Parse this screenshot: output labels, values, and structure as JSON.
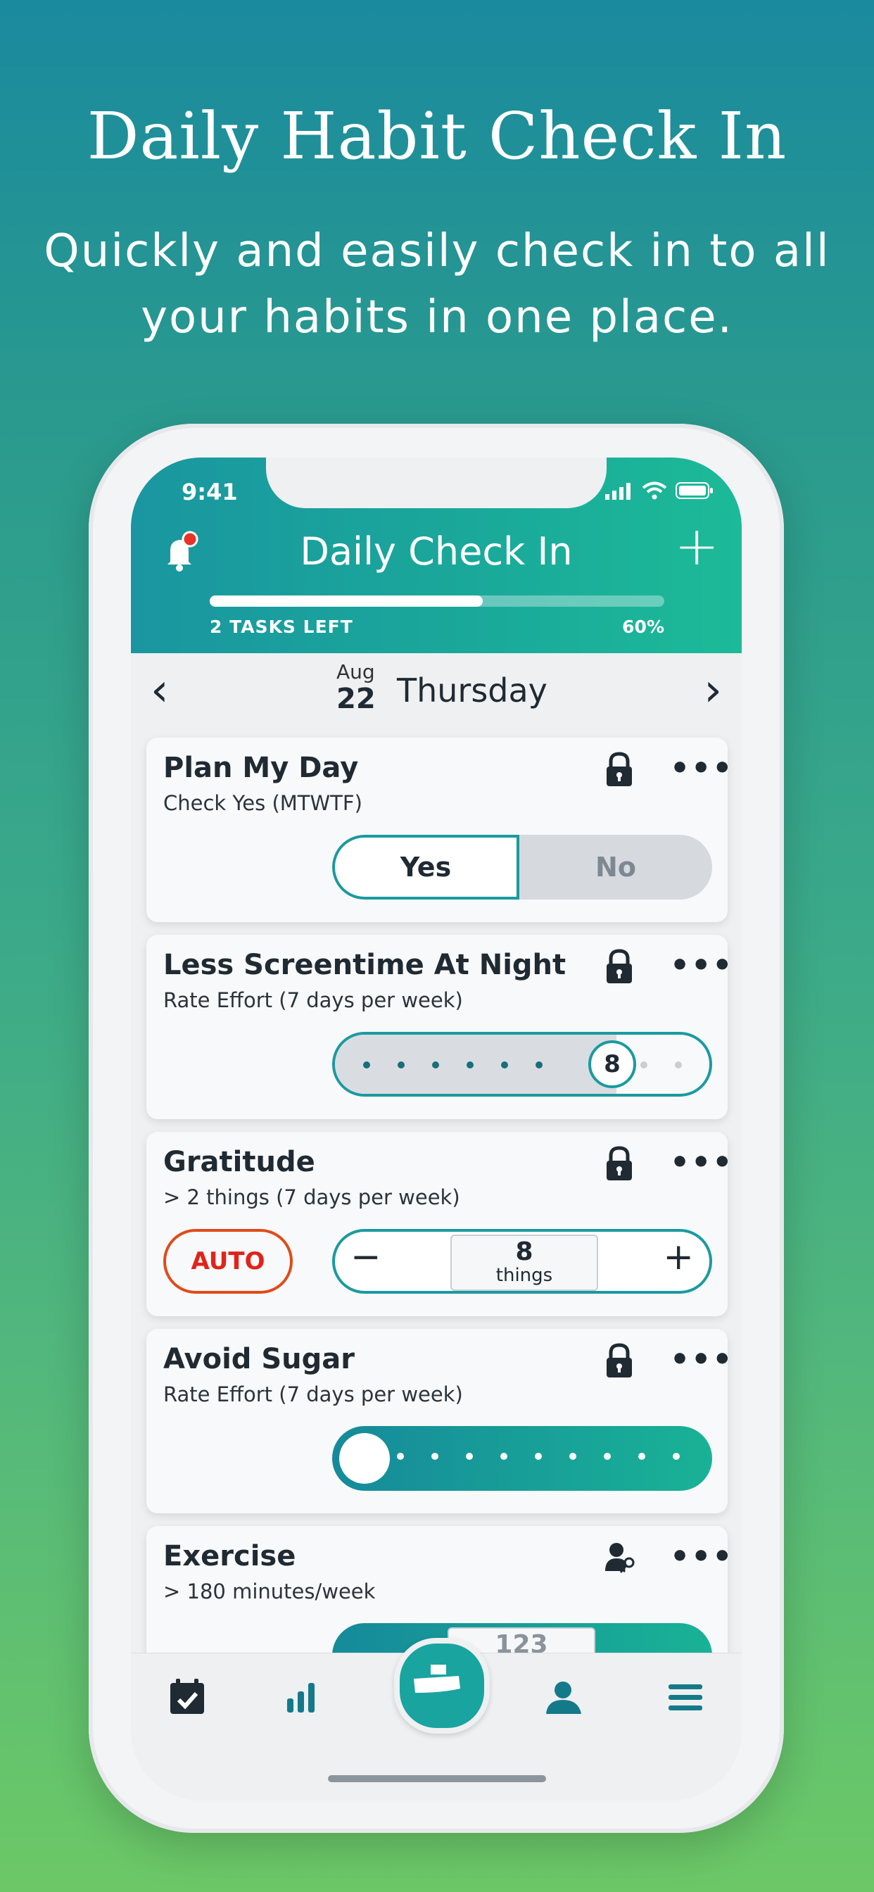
{
  "promo": {
    "headline": "Daily Habit Check In",
    "subline": "Quickly and easily check in to all your habits in one place."
  },
  "status_bar": {
    "time": "9:41"
  },
  "header": {
    "title": "Daily Check In",
    "add_label": "+",
    "tasks_left": "2 TASKS LEFT",
    "progress_label": "60%",
    "progress": 0.6
  },
  "date": {
    "prev": "‹",
    "next": "›",
    "month": "Aug",
    "day": "22",
    "weekday": "Thursday"
  },
  "habits": [
    {
      "title": "Plan My Day",
      "subtitle": "Check Yes (MTWTF)",
      "yes_label": "Yes",
      "no_label": "No",
      "selected": "Yes"
    },
    {
      "title": "Less Screentime At Night",
      "subtitle": "Rate Effort (7 days per week)",
      "rating_value": "8",
      "rating_max": 10
    },
    {
      "title": "Gratitude",
      "subtitle": "> 2 things (7 days per week)",
      "auto_label": "AUTO",
      "minus_label": "−",
      "plus_label": "+",
      "value": "8",
      "unit": "things"
    },
    {
      "title": "Avoid Sugar",
      "subtitle": "Rate Effort (7 days per week)",
      "rating_value": 0
    },
    {
      "title": "Exercise",
      "subtitle": "> 180 minutes/week",
      "value": "123"
    }
  ],
  "icons": {
    "bell": "bell-icon",
    "lock": "lock-icon",
    "more": "more-icon",
    "coach": "coach-key-icon",
    "tab_checkin": "calendar-check-icon",
    "tab_stats": "bar-chart-icon",
    "tab_home": "habit-home-icon",
    "tab_profile": "person-icon",
    "tab_menu": "menu-icon"
  },
  "colors": {
    "accent": "#1a9aa0",
    "auto": "#e0241a",
    "notification": "#e8322a"
  }
}
